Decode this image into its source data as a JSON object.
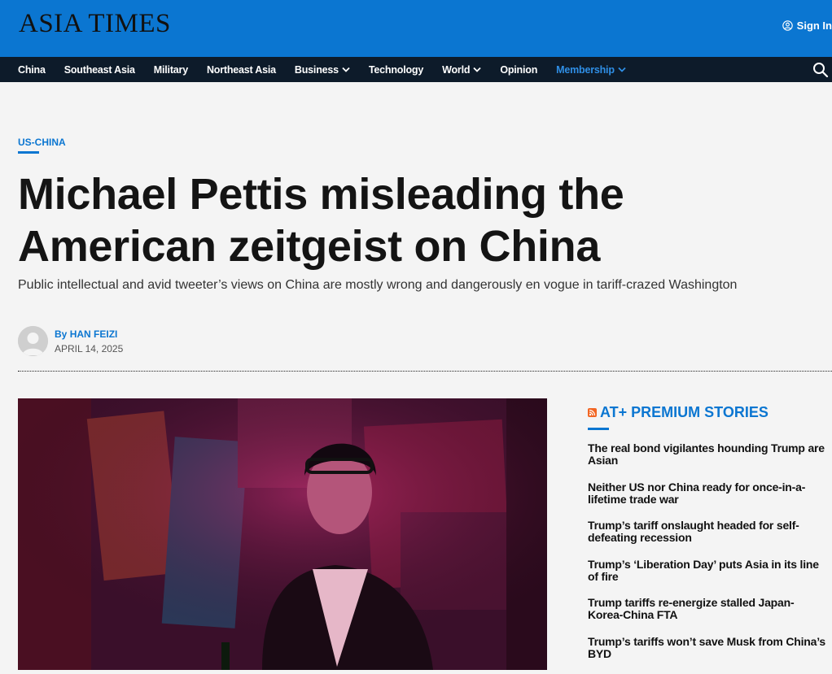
{
  "header": {
    "logo_text": "ASIA TIMES",
    "signin_label": "Sign In",
    "brand_color": "#0b76d1"
  },
  "nav": {
    "items": [
      {
        "label": "China",
        "has_dropdown": false
      },
      {
        "label": "Southeast Asia",
        "has_dropdown": false
      },
      {
        "label": "Military",
        "has_dropdown": false
      },
      {
        "label": "Northeast Asia",
        "has_dropdown": false
      },
      {
        "label": "Business",
        "has_dropdown": true
      },
      {
        "label": "Technology",
        "has_dropdown": false
      },
      {
        "label": "World",
        "has_dropdown": true
      },
      {
        "label": "Opinion",
        "has_dropdown": false
      },
      {
        "label": "Membership",
        "has_dropdown": true
      }
    ],
    "search_icon": "search-icon"
  },
  "article": {
    "category": "US-CHINA",
    "headline": "Michael Pettis misleading the American zeitgeist on China",
    "subtitle": "Public intellectual and avid tweeter’s views on China are mostly wrong and dangerously en vogue in tariff-crazed Washington",
    "byline_prefix": "By",
    "author": "HAN FEIZI",
    "date": "APRIL 14, 2025"
  },
  "sidebar": {
    "title": "AT+ PREMIUM STORIES",
    "icon": "rss-icon",
    "stories": [
      "The real bond vigilantes hounding Trump are Asian",
      "Neither US nor China ready for once-in-a-lifetime trade war",
      "Trump’s tariff onslaught headed for self-defeating recession",
      "Trump’s ‘Liberation Day’ puts Asia in its line of fire",
      "Trump tariffs re-energize stalled Japan-Korea-China FTA",
      "Trump’s tariffs won’t save Musk from China’s BYD"
    ]
  }
}
